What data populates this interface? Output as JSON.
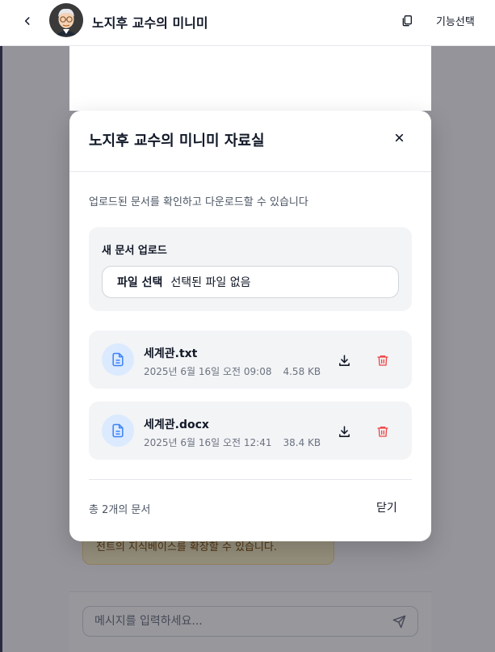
{
  "header": {
    "title": "노지후 교수의 미니미",
    "feature_label": "기능선택"
  },
  "chat": {
    "hint_text": "전트의 지식베이스를 확장할 수 있습니다.",
    "input_placeholder": "메시지를 입력하세요..."
  },
  "modal": {
    "title": "노지후 교수의 미니미 자료실",
    "description": "업로드된 문서를 확인하고 다운로드할 수 있습니다",
    "upload": {
      "title": "새 문서 업로드",
      "choose_label": "파일 선택",
      "no_file_label": "선택된 파일 없음"
    },
    "documents": [
      {
        "name": "세계관.txt",
        "date": "2025년 6월 16일 오전 09:08",
        "size": "4.58 KB"
      },
      {
        "name": "세계관.docx",
        "date": "2025년 6월 16일 오전 12:41",
        "size": "38.4 KB"
      }
    ],
    "footer": {
      "count_label": "총 2개의 문서",
      "close_label": "닫기"
    }
  },
  "colors": {
    "accent_blue": "#3b82f6",
    "danger_red": "#ef4444",
    "hint_bg": "#fef3c7"
  }
}
